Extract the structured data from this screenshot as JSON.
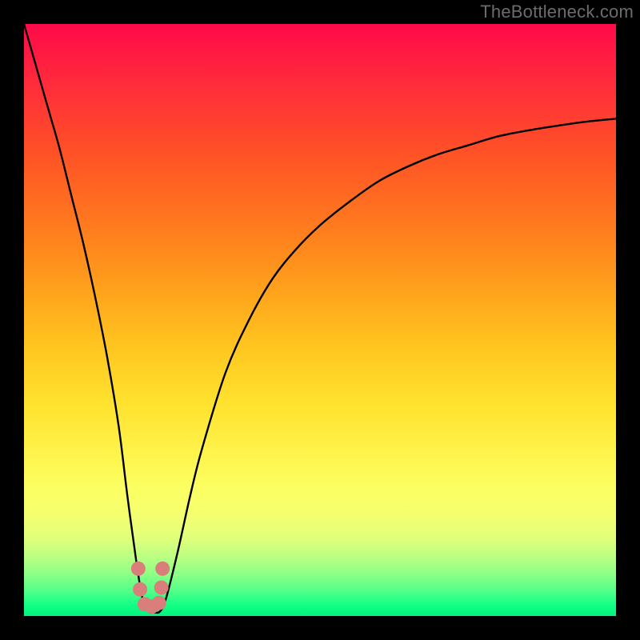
{
  "watermark": "TheBottleneck.com",
  "colors": {
    "frame": "#000000",
    "curve": "#000000",
    "marker": "#d97e7a"
  },
  "chart_data": {
    "type": "line",
    "title": "",
    "xlabel": "",
    "ylabel": "",
    "xlim": [
      0,
      100
    ],
    "ylim": [
      0,
      100
    ],
    "grid": false,
    "legend": false,
    "x": [
      0,
      2,
      4,
      6,
      8,
      10,
      12,
      14,
      16,
      17.5,
      19,
      20,
      21,
      22,
      23,
      24,
      26,
      28,
      30,
      34,
      38,
      42,
      46,
      50,
      55,
      60,
      65,
      70,
      75,
      80,
      85,
      90,
      95,
      100
    ],
    "values": [
      100,
      93,
      86,
      79,
      71,
      63,
      54,
      44,
      32,
      20,
      9,
      3,
      0.8,
      0.6,
      0.8,
      3,
      11,
      20,
      28,
      41,
      50,
      57,
      62,
      66,
      70,
      73.5,
      76,
      78,
      79.5,
      81,
      82,
      82.8,
      83.5,
      84
    ],
    "markers": {
      "x": [
        19.3,
        19.6,
        20.4,
        21.6,
        22.8,
        23.2,
        23.4
      ],
      "y": [
        8,
        4.5,
        2.0,
        1.6,
        2.2,
        4.8,
        8
      ],
      "radius": 9
    },
    "note": "values are read from pixel positions; x is normalized 0-100 left-to-right, y is 0 at bottom (green) to 100 at top (red)."
  }
}
